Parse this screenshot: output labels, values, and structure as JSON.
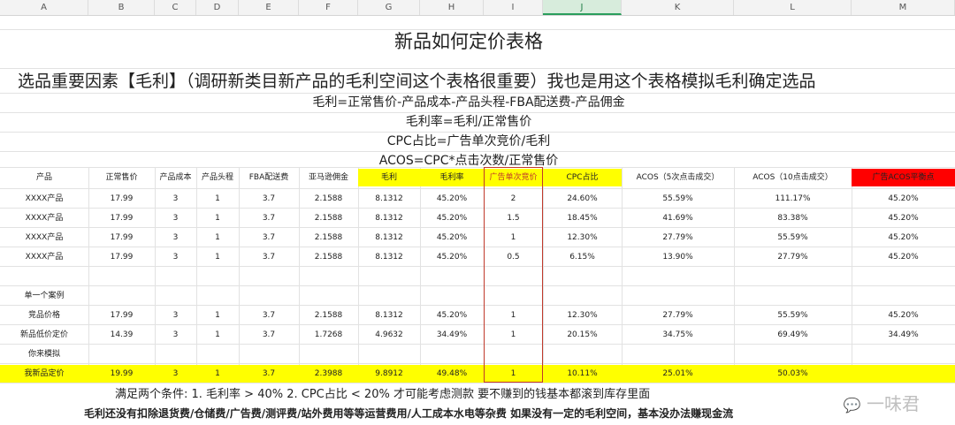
{
  "columns": [
    "A",
    "B",
    "C",
    "D",
    "E",
    "F",
    "G",
    "H",
    "I",
    "J",
    "K",
    "L",
    "M"
  ],
  "title": "新品如何定价表格",
  "subtitle": "选品重要因素【毛利】（调研新类目新产品的毛利空间这个表格很重要）我也是用这个表格模拟毛利确定选品",
  "formulas": [
    "毛利=正常售价-产品成本-产品头程-FBA配送费-产品佣金",
    "毛利率=毛利/正常售价",
    "CPC占比=广告单次竞价/毛利",
    "ACOS=CPC*点击次数/正常售价"
  ],
  "headers": [
    "产品",
    "正常售价",
    "产品成本",
    "产品头程",
    "FBA配送费",
    "亚马逊佣金",
    "毛利",
    "毛利率",
    "广告单次竞价",
    "CPC占比",
    "ACOS（5次点击成交）",
    "ACOS（10点击成交）",
    "广告ACOS平衡点"
  ],
  "rows": [
    [
      "XXXX产品",
      "17.99",
      "3",
      "1",
      "3.7",
      "2.1588",
      "8.1312",
      "45.20%",
      "2",
      "24.60%",
      "55.59%",
      "111.17%",
      "45.20%"
    ],
    [
      "XXXX产品",
      "17.99",
      "3",
      "1",
      "3.7",
      "2.1588",
      "8.1312",
      "45.20%",
      "1.5",
      "18.45%",
      "41.69%",
      "83.38%",
      "45.20%"
    ],
    [
      "XXXX产品",
      "17.99",
      "3",
      "1",
      "3.7",
      "2.1588",
      "8.1312",
      "45.20%",
      "1",
      "12.30%",
      "27.79%",
      "55.59%",
      "45.20%"
    ],
    [
      "XXXX产品",
      "17.99",
      "3",
      "1",
      "3.7",
      "2.1588",
      "8.1312",
      "45.20%",
      "0.5",
      "6.15%",
      "13.90%",
      "27.79%",
      "45.20%"
    ]
  ],
  "section_label": "单一个案例",
  "case_rows": [
    [
      "竞品价格",
      "17.99",
      "3",
      "1",
      "3.7",
      "2.1588",
      "8.1312",
      "45.20%",
      "1",
      "12.30%",
      "27.79%",
      "55.59%",
      "45.20%"
    ],
    [
      "新品低价定价",
      "14.39",
      "3",
      "1",
      "3.7",
      "1.7268",
      "4.9632",
      "34.49%",
      "1",
      "20.15%",
      "34.75%",
      "69.49%",
      "34.49%"
    ]
  ],
  "simulate_label": "你来模拟",
  "my_row": [
    "我新品定价",
    "19.99",
    "3",
    "1",
    "3.7",
    "2.3988",
    "9.8912",
    "49.48%",
    "1",
    "10.11%",
    "25.01%",
    "50.03%",
    ""
  ],
  "conditions": "满足两个条件:   1. 毛利率 > 40%          2. CPC占比 < 20%          才可能考虑测款 要不赚到的钱基本都滚到库存里面",
  "footer": "毛利还没有扣除退货费/仓储费/广告费/测评费/站外费用等等运营费用/人工成本水电等杂费   如果没有一定的毛利空间，基本没办法赚现金流",
  "watermark": "一味君",
  "colors": {
    "highlight": "#ffff00",
    "alert": "#ff0000",
    "selected_col": "#2a9d5c"
  }
}
